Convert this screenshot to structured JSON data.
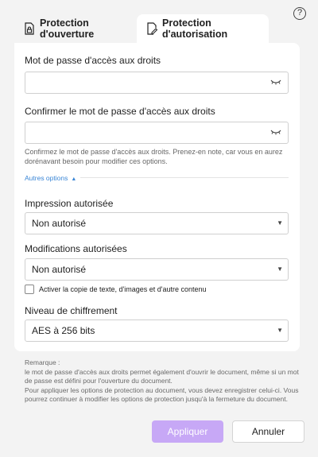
{
  "help": {
    "label": "?"
  },
  "tabs": [
    {
      "label": "Protection d'ouverture",
      "icon": "lock-document-icon",
      "active": false
    },
    {
      "label": "Protection d'autorisation",
      "icon": "edit-document-icon",
      "active": true
    }
  ],
  "password": {
    "label": "Mot de passe d'accès aux droits",
    "value": "",
    "placeholder": ""
  },
  "confirm": {
    "label": "Confirmer le mot de passe d'accès aux droits",
    "value": "",
    "placeholder": "",
    "hint": "Confirmez le mot de passe d'accès aux droits. Prenez-en note, car vous en aurez dorénavant besoin pour modifier ces options."
  },
  "more_options": {
    "label": "Autres options",
    "expanded": true
  },
  "printing": {
    "label": "Impression autorisée",
    "value": "Non autorisé"
  },
  "changes": {
    "label": "Modifications autorisées",
    "value": "Non autorisé"
  },
  "copy_checkbox": {
    "label": "Activer la copie de texte, d'images et d'autre contenu",
    "checked": false
  },
  "encryption": {
    "label": "Niveau de chiffrement",
    "value": "AES à 256 bits"
  },
  "remark": {
    "title": "Remarque :",
    "line1": "le mot de passe d'accès aux droits permet également d'ouvrir le document, même si un mot de passe est défini pour l'ouverture du document.",
    "line2": "Pour appliquer les options de protection au document, vous devez enregistrer celui-ci. Vous pourrez continuer à modifier les options de protection jusqu'à la fermeture du document."
  },
  "buttons": {
    "apply": "Appliquer",
    "cancel": "Annuler"
  },
  "colors": {
    "accent": "#c7a8f6",
    "link": "#3a86d6"
  }
}
